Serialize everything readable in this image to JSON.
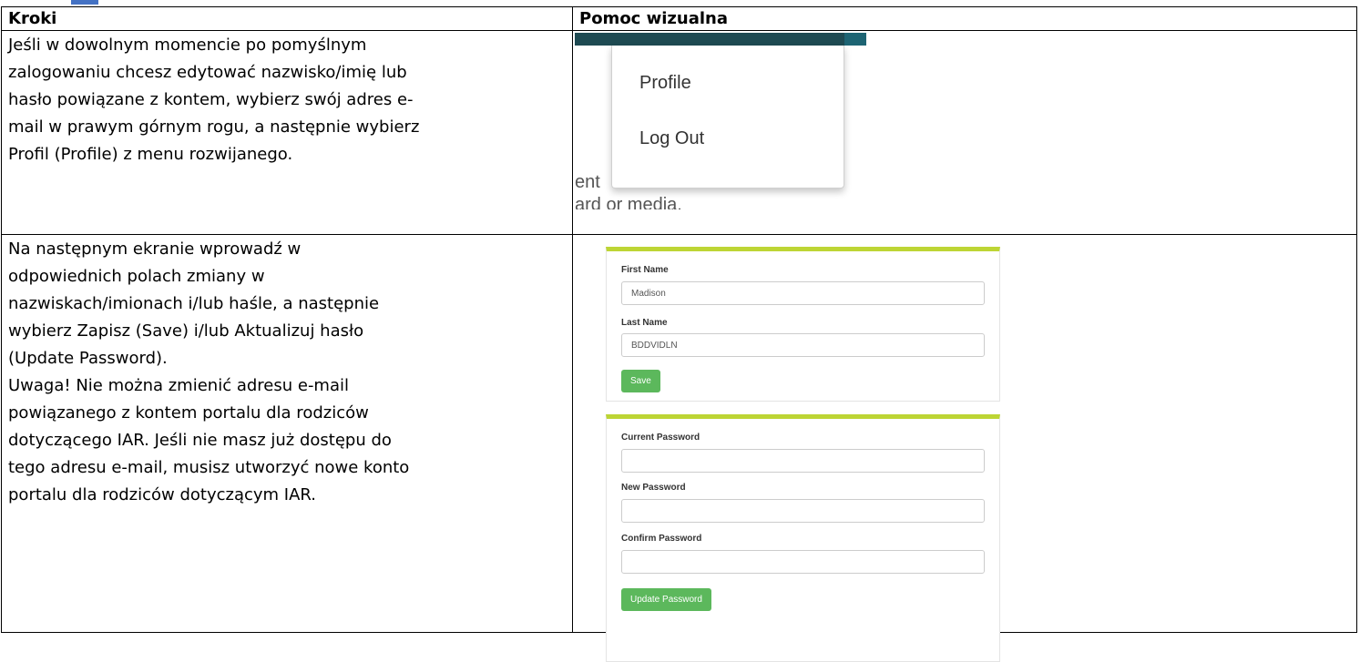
{
  "table": {
    "header_steps": "Kroki",
    "header_visual": "Pomoc wizualna"
  },
  "rows": [
    {
      "text": [
        "Jeśli w dowolnym momencie po pomyślnym",
        "zalogowaniu chcesz edytować nazwisko/imię lub",
        "hasło powiązane z kontem, wybierz swój adres e-",
        "mail w prawym górnym rogu, a następnie wybierz",
        "Profil (Profile) z menu rozwijanego."
      ]
    },
    {
      "text": [
        "Na następnym ekranie wprowadź w",
        "odpowiednich polach zmiany w",
        "nazwiskach/imionach i/lub haśle, a następnie",
        "wybierz Zapisz (Save) i/lub Aktualizuj hasło",
        "(Update Password).",
        "Uwaga! Nie można zmienić adresu e-mail",
        "powiązanego z kontem portalu dla rodziców",
        "dotyczącego IAR. Jeśli nie masz już dostępu do",
        "tego adresu e-mail, musisz utworzyć nowe konto",
        "portalu dla rodziców dotyczącym IAR."
      ]
    }
  ],
  "dropdown_screenshot": {
    "menu_items": [
      "Profile",
      "Log Out"
    ],
    "background_fragments": [
      "ent",
      "ard or media."
    ]
  },
  "profile_screenshot": {
    "first_name_label": "First Name",
    "first_name_value": "Madison",
    "last_name_label": "Last Name",
    "last_name_value": "BDDVIDLN",
    "save_label": "Save",
    "current_password_label": "Current Password",
    "current_password_value": "",
    "new_password_label": "New Password",
    "new_password_value": "",
    "confirm_password_label": "Confirm Password",
    "confirm_password_value": "",
    "update_password_label": "Update Password"
  },
  "colors": {
    "navbar": "#1e4a52",
    "panel_accent": "#bdd534",
    "button_green": "#5cb85c",
    "heading_mark": "#4472c4"
  }
}
